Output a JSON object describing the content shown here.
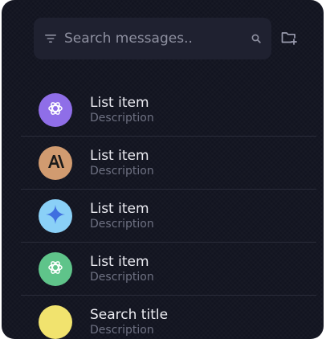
{
  "search": {
    "placeholder": "Search messages.."
  },
  "icons": {
    "filter": "filter-icon",
    "search": "search-icon",
    "new_folder": "new-folder-icon"
  },
  "colors": {
    "background": "#121420",
    "search_bg": "#1f2130",
    "title_text": "#ececf2",
    "desc_text": "#6e7182",
    "divider": "#2a2c3a"
  },
  "list": {
    "items": [
      {
        "title": "List item",
        "description": "Description",
        "avatar_icon": "openai-logo-icon",
        "avatar_color": "#8f6ee8"
      },
      {
        "title": "List item",
        "description": "Description",
        "avatar_icon": "anthropic-logo-icon",
        "avatar_color": "#d19b70"
      },
      {
        "title": "List item",
        "description": "Description",
        "avatar_icon": "gemini-sparkle-icon",
        "avatar_color": "#8ad0f7"
      },
      {
        "title": "List item",
        "description": "Description",
        "avatar_icon": "openai-logo-icon",
        "avatar_color": "#5fc48a"
      },
      {
        "title": "Search title",
        "description": "Description",
        "avatar_icon": "blank-avatar",
        "avatar_color": "#f1e36e"
      }
    ]
  }
}
